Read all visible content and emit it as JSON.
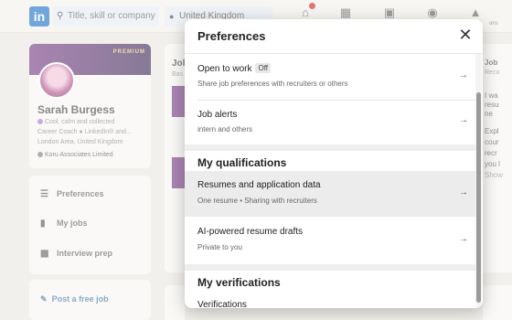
{
  "topbar": {
    "logo": "in",
    "search_placeholder": "Title, skill or company",
    "location_value": "United Kingdom",
    "nav_partial_label": "ons"
  },
  "profile": {
    "premium_label": "PREMIUM",
    "name": "Sarah Burgess",
    "headline_1": "Cool, calm and collected",
    "headline_2": "Career Coach ● LinkedIn® and...",
    "location": "London Area, United Kingdom",
    "company": "Koru Associates Limited"
  },
  "left_nav": {
    "preferences": "Preferences",
    "my_jobs": "My jobs",
    "interview_prep": "Interview prep",
    "post_job": "Post a free job"
  },
  "mid": {
    "title": "Job",
    "sub": "Bas"
  },
  "right": {
    "lines": [
      "Job",
      "Reco",
      "I wa",
      "resu",
      "ne",
      "Expl",
      "cour",
      "recr",
      "you l",
      "Show"
    ]
  },
  "modal": {
    "title": "Preferences",
    "close": "✕",
    "rows": [
      {
        "title": "Open to work",
        "badge": "Off",
        "sub": "Share job preferences with recruiters or others"
      },
      {
        "title": "Job alerts",
        "sub": "intern and others"
      }
    ],
    "qualifications": {
      "heading": "My qualifications",
      "rows": [
        {
          "title": "Resumes and application data",
          "sub": "One resume • Sharing with recruiters"
        },
        {
          "title": "AI-powered resume drafts",
          "sub": "Private to you"
        }
      ]
    },
    "verifications": {
      "heading": "My verifications",
      "rows": [
        {
          "title": "Verifications"
        }
      ]
    },
    "arrow": "→"
  },
  "colors": {
    "brand": "#0a66c2",
    "hover_row": "#ececec",
    "premium_gold": "#e9c46a"
  }
}
